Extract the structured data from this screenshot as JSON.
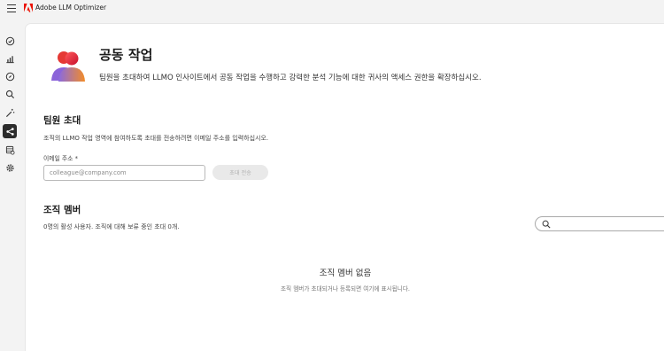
{
  "app": {
    "title": "Adobe LLM Optimizer",
    "logo_icon": "adobe-logo-icon",
    "brand_color": "#eb1000"
  },
  "nav": {
    "items": [
      {
        "icon": "dashboard-check-icon",
        "active": false
      },
      {
        "icon": "bar-chart-icon",
        "active": false
      },
      {
        "icon": "compass-icon",
        "active": false
      },
      {
        "icon": "search-icon",
        "active": false
      },
      {
        "icon": "magic-wand-icon",
        "active": false
      },
      {
        "icon": "share-icon",
        "active": true
      },
      {
        "icon": "data-settings-icon",
        "active": false
      },
      {
        "icon": "gear-icon",
        "active": false
      }
    ]
  },
  "page": {
    "title": "공동 작업",
    "subtitle": "팀원을 초대하여 LLMO 인사이트에서 공동 작업을 수행하고 강력한 분석 기능에 대한 귀사의 액세스 권한을 확장하십시오."
  },
  "invite": {
    "title": "팀원 초대",
    "description": "조직의 LLMO 작업 영역에 참여하도록 초대를 전송하려면 이메일 주소를 입력하십시오.",
    "email_label": "이메일 주소 *",
    "email_placeholder": "colleague@company.com",
    "email_value": "",
    "send_button": "초대 전송"
  },
  "members": {
    "title": "조직 멤버",
    "summary": "0명의 활성 사용자. 조직에 대해 보류 중인 초대 0개.",
    "search_placeholder": "",
    "empty_title": "조직 멤버 없음",
    "empty_description": "조직 멤버가 초대되거나 등록되면 여기에 표시됩니다."
  }
}
